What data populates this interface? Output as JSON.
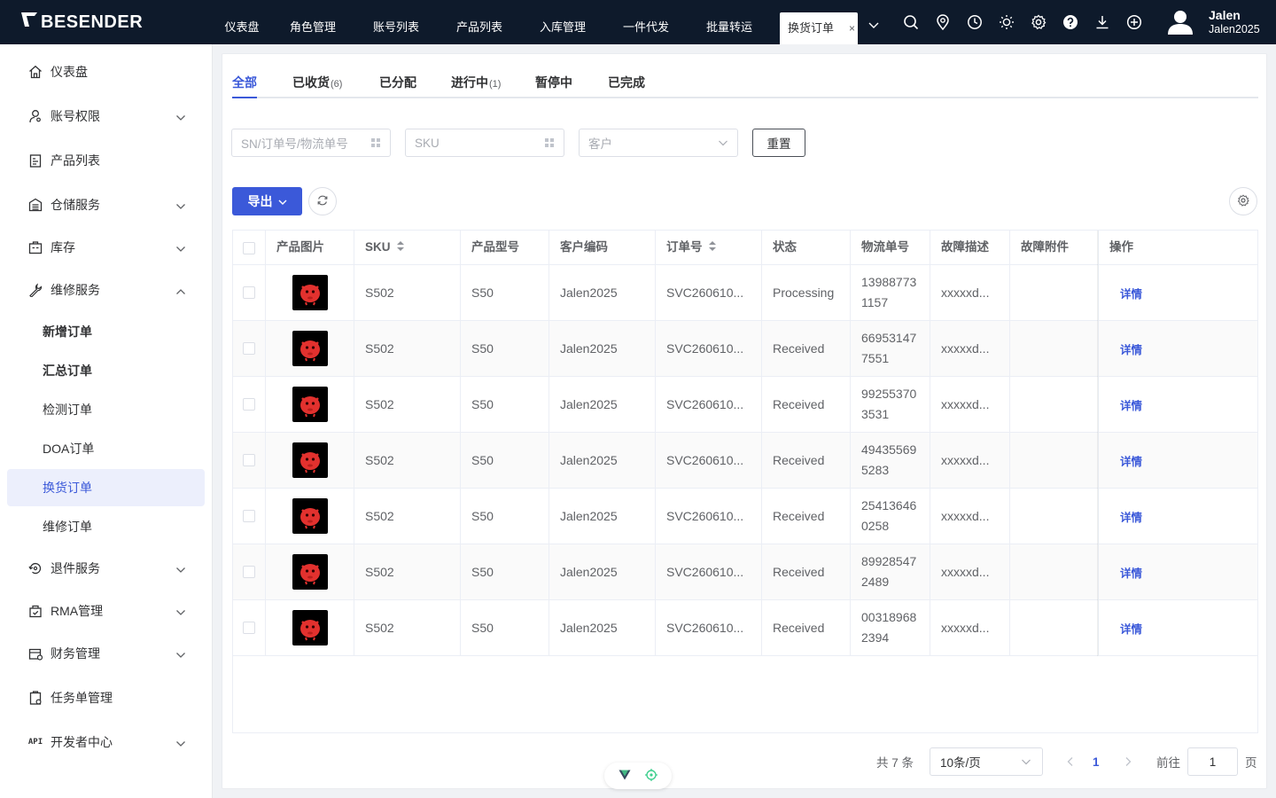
{
  "brand": {
    "name": "BESENDER"
  },
  "topnav": {
    "items": [
      "仪表盘",
      "角色管理",
      "账号列表",
      "产品列表",
      "入库管理",
      "一件代发",
      "批量转运"
    ],
    "active_tab": "换货订单",
    "close_glyph": "×",
    "icons": [
      "search-icon",
      "location-icon",
      "clock-icon",
      "sun-icon",
      "gear-icon",
      "help-icon",
      "download-icon",
      "add-circle-icon"
    ]
  },
  "user": {
    "name": "Jalen",
    "account": "Jalen2025"
  },
  "sidebar": {
    "items": [
      {
        "label": "仪表盘",
        "icon": "home-icon"
      },
      {
        "label": "账号权限",
        "icon": "user-key-icon"
      },
      {
        "label": "产品列表",
        "icon": "clipboard-icon"
      },
      {
        "label": "仓储服务",
        "icon": "warehouse-icon"
      },
      {
        "label": "库存",
        "icon": "inventory-icon"
      },
      {
        "label": "维修服务",
        "icon": "wrench-icon"
      },
      {
        "label": "退件服务",
        "icon": "return-icon"
      },
      {
        "label": "RMA管理",
        "icon": "rma-icon"
      },
      {
        "label": "财务管理",
        "icon": "finance-icon"
      },
      {
        "label": "任务单管理",
        "icon": "task-icon"
      },
      {
        "label": "开发者中心",
        "icon": "api-icon"
      }
    ],
    "sub_items": [
      "新增订单",
      "汇总订单",
      "检测订单",
      "DOA订单",
      "换货订单",
      "维修订单"
    ],
    "api_badge": "API"
  },
  "tabs": [
    {
      "label": "全部",
      "count": ""
    },
    {
      "label": "已收货",
      "count": "(6)"
    },
    {
      "label": "已分配",
      "count": ""
    },
    {
      "label": "进行中",
      "count": "(1)"
    },
    {
      "label": "暂停中",
      "count": ""
    },
    {
      "label": "已完成",
      "count": ""
    }
  ],
  "filters": {
    "search_placeholder": "SN/订单号/物流单号",
    "sku_placeholder": "SKU",
    "customer_placeholder": "客户",
    "reset_label": "重置"
  },
  "toolbar": {
    "export_label": "导出"
  },
  "table": {
    "columns": [
      "产品图片",
      "SKU",
      "产品型号",
      "客户编码",
      "订单号",
      "状态",
      "物流单号",
      "故障描述",
      "故障附件",
      "操作"
    ],
    "action_label": "详情",
    "rows": [
      {
        "sku": "S502",
        "model": "S50",
        "customer": "Jalen2025",
        "order": "SVC260610...",
        "status": "Processing",
        "tracking": "139887731157",
        "fault": "xxxxxd...",
        "attachment": ""
      },
      {
        "sku": "S502",
        "model": "S50",
        "customer": "Jalen2025",
        "order": "SVC260610...",
        "status": "Received",
        "tracking": "669531477551",
        "fault": "xxxxxd...",
        "attachment": ""
      },
      {
        "sku": "S502",
        "model": "S50",
        "customer": "Jalen2025",
        "order": "SVC260610...",
        "status": "Received",
        "tracking": "992553703531",
        "fault": "xxxxxd...",
        "attachment": ""
      },
      {
        "sku": "S502",
        "model": "S50",
        "customer": "Jalen2025",
        "order": "SVC260610...",
        "status": "Received",
        "tracking": "494355695283",
        "fault": "xxxxxd...",
        "attachment": ""
      },
      {
        "sku": "S502",
        "model": "S50",
        "customer": "Jalen2025",
        "order": "SVC260610...",
        "status": "Received",
        "tracking": "254136460258",
        "fault": "xxxxxd...",
        "attachment": ""
      },
      {
        "sku": "S502",
        "model": "S50",
        "customer": "Jalen2025",
        "order": "SVC260610...",
        "status": "Received",
        "tracking": "899285472489",
        "fault": "xxxxxd...",
        "attachment": ""
      },
      {
        "sku": "S502",
        "model": "S50",
        "customer": "Jalen2025",
        "order": "SVC260610...",
        "status": "Received",
        "tracking": "003189682394",
        "fault": "xxxxxd...",
        "attachment": ""
      }
    ]
  },
  "pagination": {
    "total_label": "共 7 条",
    "page_size": "10条/页",
    "current_page": "1",
    "goto_label": "前往",
    "goto_value": "1",
    "page_suffix": "页"
  },
  "colors": {
    "accent": "#3b59d9",
    "topbar": "#0e1a2b",
    "active_sub_bg": "#eceffc"
  }
}
